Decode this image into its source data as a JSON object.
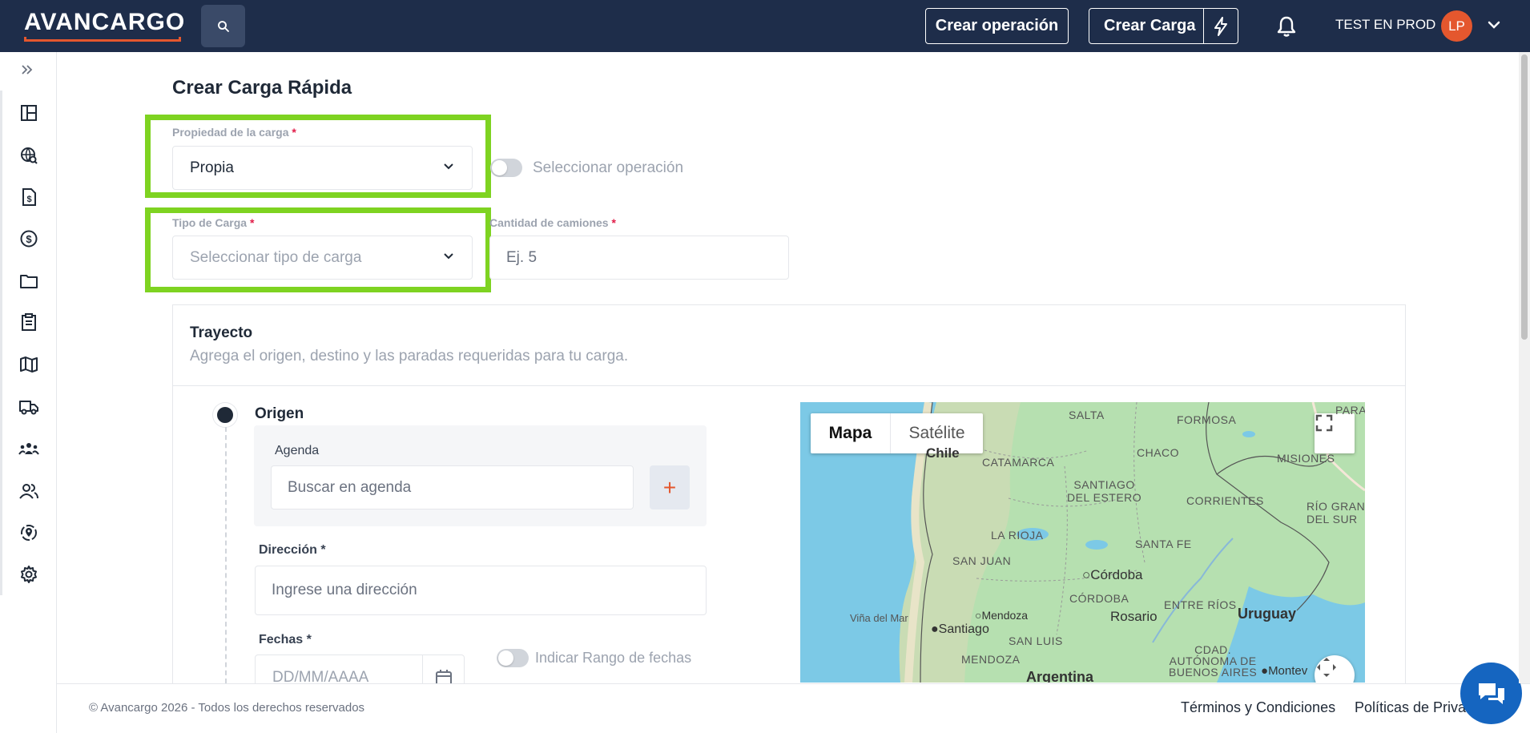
{
  "header": {
    "logo_text": "AVANCARGO",
    "crear_operacion": "Crear operación",
    "crear_carga": "Crear Carga",
    "user_name": "TEST EN PROD",
    "avatar_initials": "LP"
  },
  "sidebar": {
    "expand_icon": "double-chevron-right-icon",
    "items": [
      {
        "icon": "dashboard-icon"
      },
      {
        "icon": "globe-search-icon"
      },
      {
        "icon": "invoice-icon"
      },
      {
        "icon": "dollar-circle-icon"
      },
      {
        "icon": "folder-icon"
      },
      {
        "icon": "clipboard-icon"
      },
      {
        "icon": "map-icon"
      },
      {
        "icon": "truck-icon"
      },
      {
        "icon": "team-icon"
      },
      {
        "icon": "users-icon"
      },
      {
        "icon": "location-target-icon"
      },
      {
        "icon": "gear-icon"
      }
    ]
  },
  "form": {
    "title": "Crear Carga Rápida",
    "propiedad_label": "Propiedad de la carga",
    "propiedad_value": "Propia",
    "seleccionar_operacion": "Seleccionar operación",
    "tipo_label": "Tipo de Carga",
    "tipo_placeholder": "Seleccionar tipo de carga",
    "cantidad_label": "Cantidad de camiones",
    "cantidad_placeholder": "Ej. 5",
    "required_mark": "*"
  },
  "trayecto": {
    "title": "Trayecto",
    "subtitle": "Agrega el origen, destino y las paradas requeridas para tu carga.",
    "origen": "Origen",
    "agenda_label": "Agenda",
    "agenda_placeholder": "Buscar en agenda",
    "add_symbol": "+",
    "direccion_label": "Dirección *",
    "direccion_placeholder": "Ingrese una dirección",
    "fechas_label": "Fechas *",
    "fecha_placeholder": "DD/MM/AAAA",
    "rango_label": "Indicar Rango de fechas"
  },
  "map": {
    "tab_mapa": "Mapa",
    "tab_satelite": "Satélite",
    "labels": {
      "salta": "SALTA",
      "formosa": "FORMOSA",
      "para": "PARA",
      "chile_top": "Chile",
      "chaco": "CHACO",
      "misiones": "MISIONES",
      "catamarca": "CATAMARCA",
      "santiago_del_estero": "SANTIAGO\nDEL ESTERO",
      "corrientes": "CORRIENTES",
      "rio_grande": "RÍO GRAN\nDEL SUR",
      "la_rioja": "LA RIOJA",
      "santa_fe": "SANTA FE",
      "san_juan": "SAN JUAN",
      "cordoba_city": "Córdoba",
      "cordoba_prov": "CÓRDOBA",
      "entre_rios": "ENTRE RÍOS",
      "vina_del_mar": "Viña del Mar",
      "mendoza_city": "Mendoza",
      "rosario": "Rosario",
      "uruguay": "Uruguay",
      "santiago": "Santiago",
      "san_luis": "SAN LUIS",
      "mendoza_prov": "MENDOZA",
      "cdad_buenos_aires": "CDAD.\nAUTÓNOMA DE\nBUENOS AIRES",
      "montevideo": "Montev",
      "argentina": "Argentina"
    }
  },
  "footer": {
    "copyright": "© Avancargo 2026 - Todos los derechos reservados",
    "terminos": "Términos y Condiciones",
    "politicas": "Políticas de Privac"
  },
  "colors": {
    "header_bg": "#1e2d4a",
    "accent": "#e4572e",
    "highlight": "#7ed321",
    "chat": "#1565c0"
  }
}
